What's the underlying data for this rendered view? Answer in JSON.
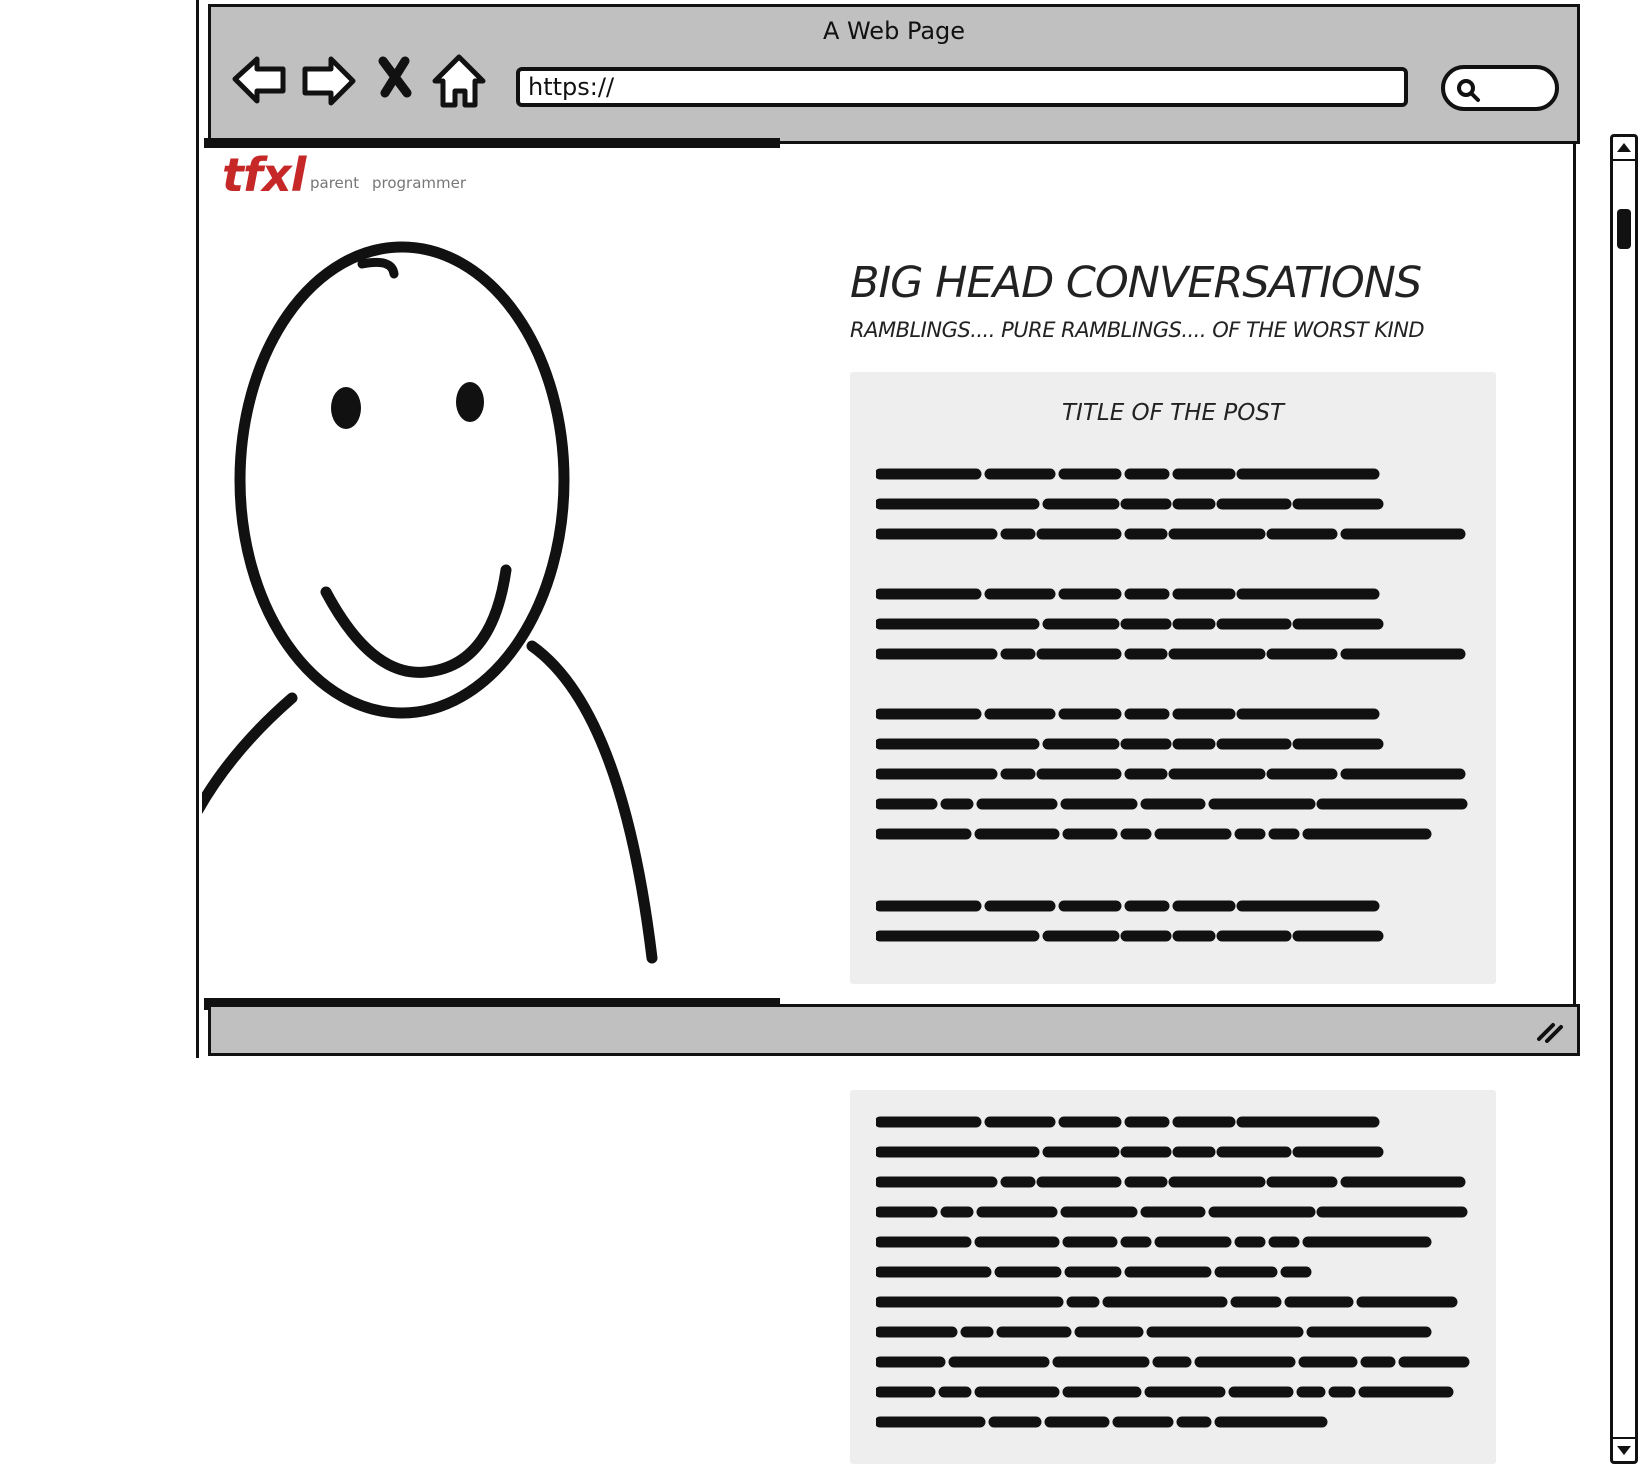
{
  "browser": {
    "window_title": "A Web Page",
    "url": "https://",
    "nav_icons": [
      "back-arrow-icon",
      "forward-arrow-icon",
      "stop-icon",
      "home-icon"
    ],
    "search_icon": "magnifier-icon"
  },
  "site": {
    "logo": "tfxl",
    "logo_color": "#c62828",
    "nav": [
      "parent",
      "programmer"
    ]
  },
  "blog": {
    "title": "BIG HEAD CONVERSATIONS",
    "subtitle": "RAMBLINGS.... PURE RAMBLINGS.... OF THE WORST KIND"
  },
  "posts": [
    {
      "title": "TITLE OF THE POST",
      "paragraph_line_counts": [
        3,
        3,
        5,
        2
      ]
    },
    {
      "title": "",
      "paragraph_line_counts": [
        11
      ]
    }
  ],
  "colors": {
    "chrome": "#c0c0c0",
    "card": "#eeeeee",
    "ink": "#111111"
  }
}
